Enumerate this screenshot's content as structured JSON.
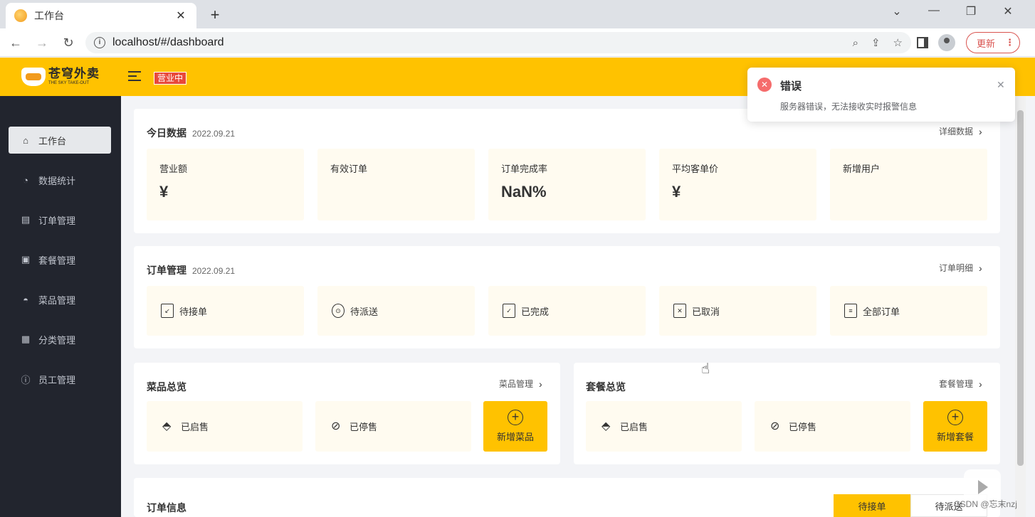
{
  "browser": {
    "tab_title": "工作台",
    "url": "localhost/#/dashboard",
    "update_label": "更新"
  },
  "header": {
    "logo_cn": "苍穹外卖",
    "logo_en": "THE SKY TAKE-OUT",
    "status": "营业中"
  },
  "sidebar": {
    "items": [
      {
        "label": "工作台",
        "icon": "home-icon"
      },
      {
        "label": "数据统计",
        "icon": "chart-icon"
      },
      {
        "label": "订单管理",
        "icon": "clipboard-icon"
      },
      {
        "label": "套餐管理",
        "icon": "gift-icon"
      },
      {
        "label": "菜品管理",
        "icon": "dish-icon"
      },
      {
        "label": "分类管理",
        "icon": "grid-icon"
      },
      {
        "label": "员工管理",
        "icon": "info-icon"
      }
    ]
  },
  "today": {
    "title": "今日数据",
    "date": "2022.09.21",
    "link": "详细数据",
    "stats": [
      {
        "label": "营业额",
        "value": "¥"
      },
      {
        "label": "有效订单",
        "value": ""
      },
      {
        "label": "订单完成率",
        "value": "NaN%"
      },
      {
        "label": "平均客单价",
        "value": "¥"
      },
      {
        "label": "新增用户",
        "value": ""
      }
    ]
  },
  "orders": {
    "title": "订单管理",
    "date": "2022.09.21",
    "link": "订单明细",
    "items": [
      {
        "label": "待接单"
      },
      {
        "label": "待派送"
      },
      {
        "label": "已完成"
      },
      {
        "label": "已取消"
      },
      {
        "label": "全部订单"
      }
    ]
  },
  "dishes": {
    "title": "菜品总览",
    "link": "菜品管理",
    "on_sale": "已启售",
    "off_sale": "已停售",
    "add": "新增菜品"
  },
  "setmeals": {
    "title": "套餐总览",
    "link": "套餐管理",
    "on_sale": "已启售",
    "off_sale": "已停售",
    "add": "新增套餐"
  },
  "order_info": {
    "title": "订单信息",
    "tabs": [
      "待接单",
      "待派送"
    ]
  },
  "notification": {
    "title": "错误",
    "message": "服务器错误，无法接收实时报警信息"
  },
  "watermark": "CSDN @忘末nzj",
  "colors": {
    "brand": "#ffc200",
    "sidebar": "#22252e",
    "error": "#f56c6c"
  }
}
